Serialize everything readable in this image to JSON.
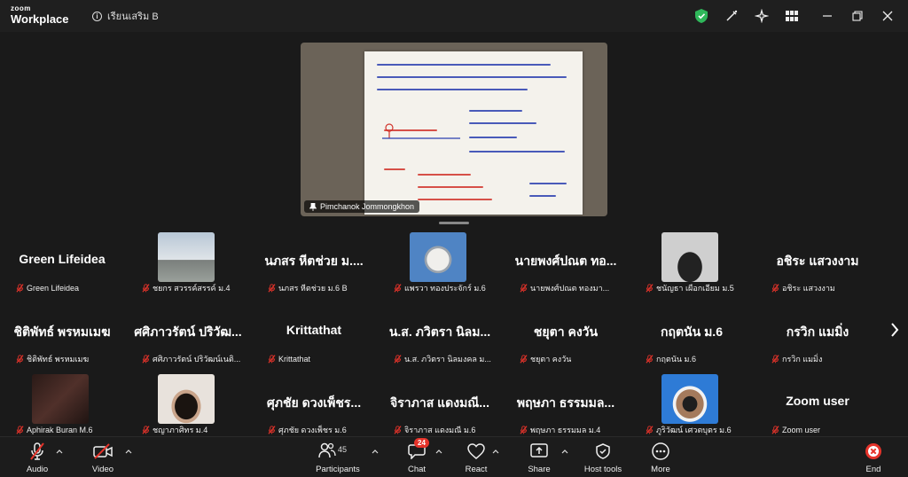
{
  "app": {
    "logo_top": "zoom",
    "logo_bottom": "Workplace",
    "meeting_name": "เรียนเสริม B"
  },
  "share": {
    "presenter": "Pimchanok Jommongkhon"
  },
  "gallery": [
    {
      "big": "Green Lifeidea",
      "label": "Green Lifeidea",
      "video": false
    },
    {
      "big": "",
      "label": "ชยกร สวรรค์สรรค์ ม.4",
      "video": true,
      "scene": "outdoor"
    },
    {
      "big": "นภสร หีตช่วย ม....",
      "label": "นภสร หีตช่วย ม.6 B",
      "video": false
    },
    {
      "big": "",
      "label": "แพรวา ทองประจักร์ ม.6",
      "video": true,
      "scene": "cat"
    },
    {
      "big": "นายพงศ์ปณต ทอ...",
      "label": "นายพงศ์ปณต ทองมา...",
      "video": false
    },
    {
      "big": "",
      "label": "ชนัญธา เผือกเอียม ม.5",
      "video": true,
      "scene": "person"
    },
    {
      "big": "อชิระ แสวงงาม",
      "label": "อชิระ แสวงงาม",
      "video": false
    },
    {
      "big": "ชิติพัทธ์ พรหมเมฆ",
      "label": "ชิติพัทธ์ พรหมเมฆ",
      "video": false
    },
    {
      "big": "ศศิภาวรัตน์ ปริวัฒ...",
      "label": "ศศิภาวรัตน์ ปริวัฒน์เนติ...",
      "video": false
    },
    {
      "big": "Krittathat",
      "label": "Krittathat",
      "video": false
    },
    {
      "big": "น.ส. ภวิตรา นิลม...",
      "label": "น.ส. ภวิตรา นิลมงคล ม...",
      "video": false
    },
    {
      "big": "ชยุตา คงวัน",
      "label": "ชยุตา คงวัน",
      "video": false
    },
    {
      "big": "กฤตนัน ม.6",
      "label": "กฤตนัน ม.6",
      "video": false
    },
    {
      "big": "กรวิก แมมิ่ง",
      "label": "กรวิก แมมิ่ง",
      "video": false
    },
    {
      "big": "",
      "label": "Aphirak Buran M.6",
      "video": true,
      "scene": "dark"
    },
    {
      "big": "",
      "label": "ชญาภาศิทร ม.4",
      "video": true,
      "scene": "girl"
    },
    {
      "big": "ศุภชัย ดวงเพ็ชร...",
      "label": "ศุภชัย ดวงเพ็ชร ม.6",
      "video": false
    },
    {
      "big": "จิราภาส แดงมณี...",
      "label": "จิราภาส แดงมณี ม.6",
      "video": false
    },
    {
      "big": "พฤษภา ธรรมมล...",
      "label": "พฤษภา ธรรมมล ม.4",
      "video": false
    },
    {
      "big": "",
      "label": "ภูริวัฒน์ เศวตบุตร ม.6",
      "video": true,
      "scene": "blue"
    },
    {
      "big": "Zoom user",
      "label": "Zoom user",
      "video": false
    }
  ],
  "toolbar": {
    "audio": "Audio",
    "video": "Video",
    "participants": "Participants",
    "participants_count": "45",
    "chat": "Chat",
    "chat_badge": "24",
    "react": "React",
    "share": "Share",
    "host_tools": "Host tools",
    "more": "More",
    "end": "End"
  },
  "colors": {
    "shield": "#2fb75a",
    "end": "#e5332a",
    "mute": "#e5332a"
  }
}
